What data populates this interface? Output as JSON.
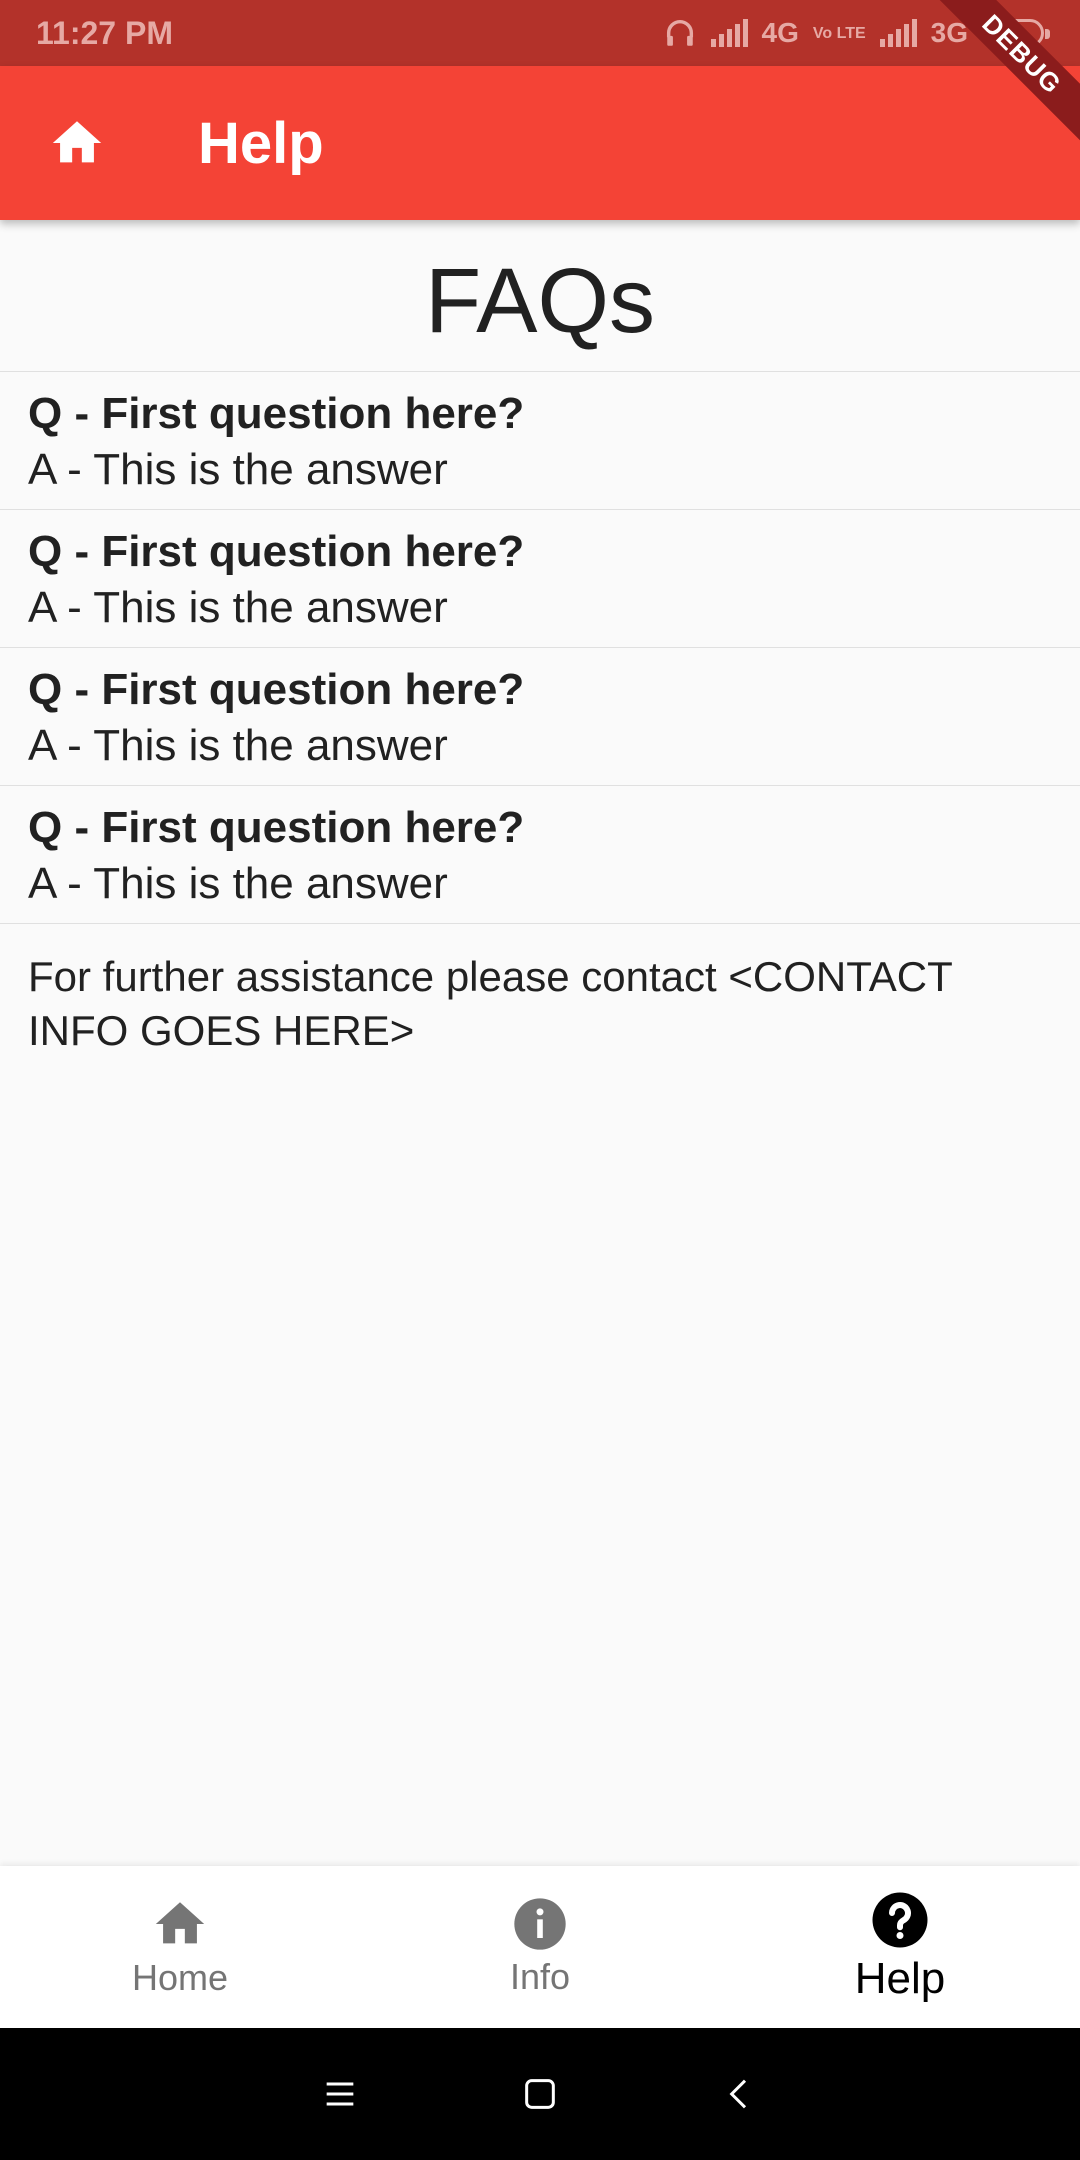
{
  "status_bar": {
    "time": "11:27 PM",
    "network_1": "4G",
    "volte": "Vo LTE",
    "network_2": "3G"
  },
  "debug_banner": "DEBUG",
  "app_bar": {
    "title": "Help",
    "icon": "home-icon",
    "color": "#f44336"
  },
  "faq": {
    "title": "FAQs",
    "items": [
      {
        "question": "Q - First question here?",
        "answer": "A - This is the answer"
      },
      {
        "question": "Q - First question here?",
        "answer": "A - This is the answer"
      },
      {
        "question": "Q - First question here?",
        "answer": "A - This is the answer"
      },
      {
        "question": "Q - First question here?",
        "answer": "A - This is the answer"
      }
    ],
    "contact_text": "For further assistance please contact <CONTACT INFO GOES HERE>"
  },
  "bottom_nav": {
    "items": [
      {
        "label": "Home",
        "icon": "home-icon",
        "active": false
      },
      {
        "label": "Info",
        "icon": "info-icon",
        "active": false
      },
      {
        "label": "Help",
        "icon": "help-icon",
        "active": true
      }
    ]
  }
}
